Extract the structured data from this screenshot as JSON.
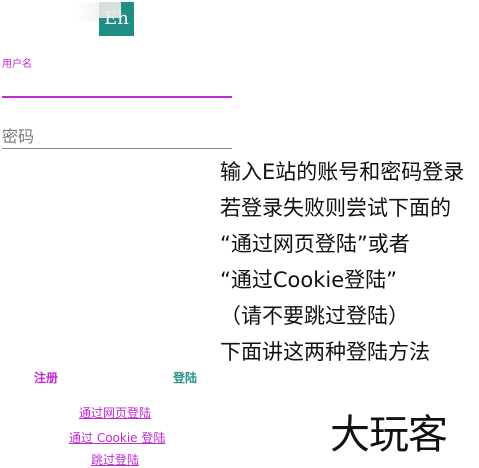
{
  "header": {
    "logo_text": "Eh"
  },
  "form": {
    "username_label": "用户名",
    "username_value": "",
    "password_placeholder": "密码",
    "password_value": ""
  },
  "overlay_lines": [
    "输入E站的账号和密码登录",
    "若登录失败则尝试下面的",
    "“通过网页登陆”或者",
    "“通过Cookie登陆”",
    "（请不要跳过登陆）",
    "下面讲这两种登陆方法"
  ],
  "actions": {
    "register_label": "注册",
    "login_label": "登陆"
  },
  "links": {
    "web_login": "通过网页登陆",
    "cookie_login": "通过 Cookie 登陆",
    "skip_login": "跳过登陆"
  },
  "watermark": {
    "text": "大玩客"
  },
  "colors": {
    "accent": "#c02ad1",
    "primary": "#2b948b",
    "logo_bg": "#1f8f86"
  }
}
